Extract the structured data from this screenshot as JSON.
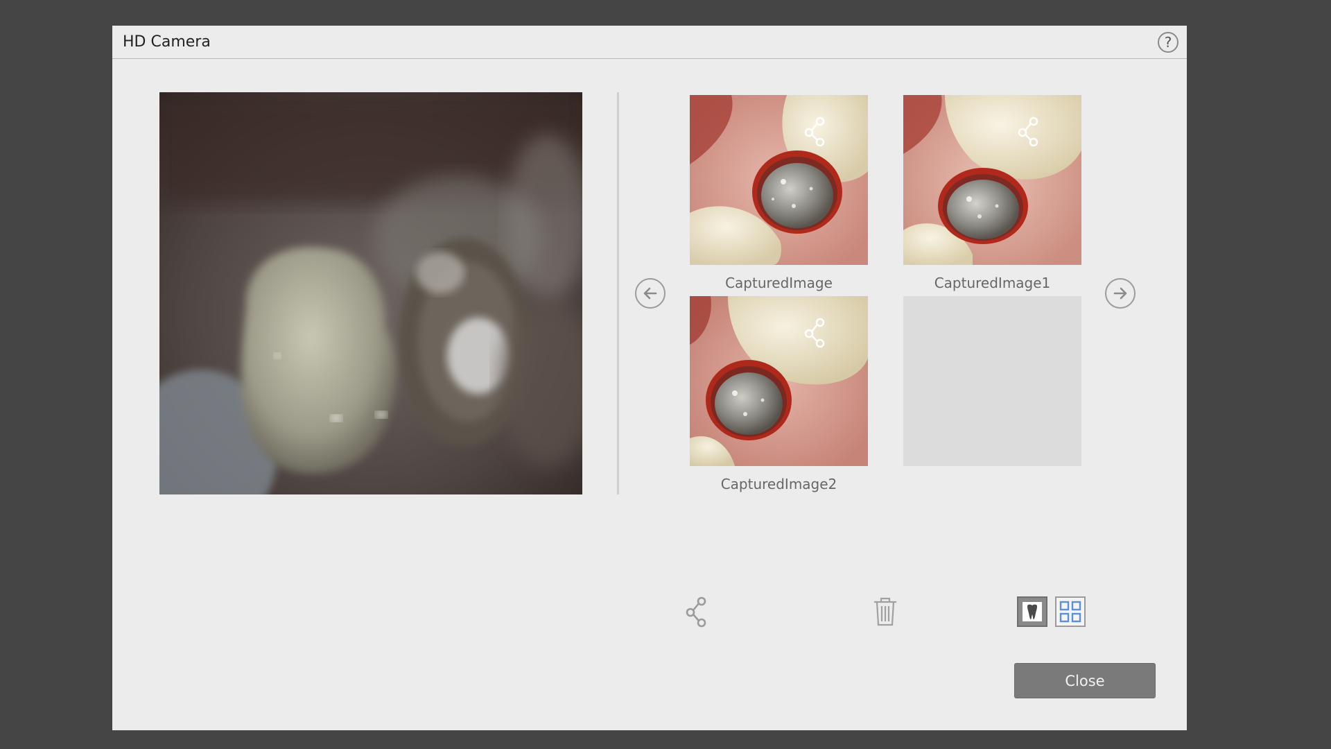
{
  "window": {
    "title": "HD Camera",
    "help_label": "?"
  },
  "thumbnails": [
    {
      "label": "CapturedImage"
    },
    {
      "label": "CapturedImage1"
    },
    {
      "label": "CapturedImage2"
    }
  ],
  "toolbar": {
    "share_icon": "share-icon",
    "delete_icon": "trash-icon",
    "single_view_icon": "tooth-icon",
    "grid_view_icon": "grid-icon"
  },
  "footer": {
    "close_label": "Close"
  },
  "colors": {
    "dialog_bg": "#ececec",
    "backdrop": "#454545",
    "button_bg": "#7a7a7a",
    "accent_blue": "#5b8fd6"
  }
}
